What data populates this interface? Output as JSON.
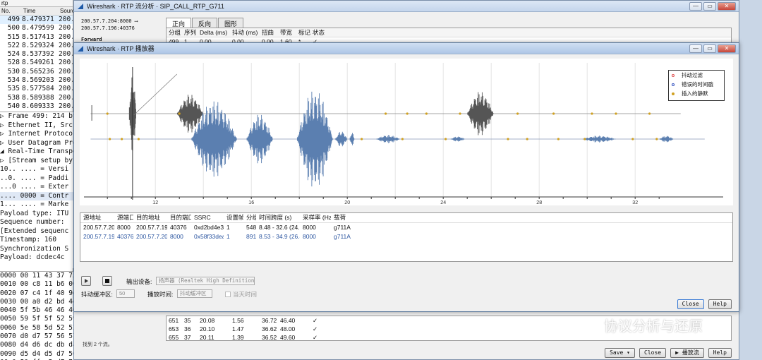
{
  "packet_list": {
    "filter_text": "rtp",
    "columns": [
      "No.",
      "Time",
      "Sourc"
    ],
    "rows": [
      {
        "no": "499",
        "time": "8.479371",
        "src": "200."
      },
      {
        "no": "500",
        "time": "8.479599",
        "src": "200."
      },
      {
        "no": "515",
        "time": "8.517413",
        "src": "200."
      },
      {
        "no": "522",
        "time": "8.529324",
        "src": "200."
      },
      {
        "no": "524",
        "time": "8.537392",
        "src": "200."
      },
      {
        "no": "528",
        "time": "8.549261",
        "src": "200."
      },
      {
        "no": "530",
        "time": "8.565236",
        "src": "200."
      },
      {
        "no": "534",
        "time": "8.569203",
        "src": "200."
      },
      {
        "no": "535",
        "time": "8.577584",
        "src": "200."
      },
      {
        "no": "538",
        "time": "8.589388",
        "src": "200."
      },
      {
        "no": "540",
        "time": "8.609333",
        "src": "200."
      }
    ]
  },
  "packet_tree": [
    "▷ Frame 499: 214 byte",
    "▷ Ethernet II, Src: 0",
    "▷ Internet Protocol V",
    "▷ User Datagram Proto",
    "◢ Real-Time Transport",
    "   ▷ [Stream setup by",
    "     10.. .... = Versi",
    "     ..0. .... = Paddi",
    "     ...0 .... = Exter",
    "     .... 0000 = Contr",
    "     1... .... = Marke",
    "     Payload type: ITU",
    "     Sequence number:",
    "     [Extended sequenc",
    "     Timestamp: 160",
    "     Synchronization S",
    "     Payload: dcdec4c"
  ],
  "hex_dump": [
    {
      "off": "0000",
      "bytes": "00 11 43 37 75"
    },
    {
      "off": "0010",
      "bytes": "00 c8 11 b6 00"
    },
    {
      "off": "0020",
      "bytes": "07 c4 1f 40 9d"
    },
    {
      "off": "0030",
      "bytes": "00 a0 d2 bd 4e"
    },
    {
      "off": "0040",
      "bytes": "5f 5b 46 46 46"
    },
    {
      "off": "0050",
      "bytes": "59 5f 5f 52 59"
    },
    {
      "off": "0060",
      "bytes": "5e 58 5d 52 52"
    },
    {
      "off": "0070",
      "bytes": "d0 d7 57 56 57"
    },
    {
      "off": "0080",
      "bytes": "d4 d6 dc db da"
    },
    {
      "off": "0090",
      "bytes": "d5 d4 d5 d7 50"
    },
    {
      "off": "00a0",
      "bytes": "50 ff e5 d7 74"
    }
  ],
  "rtp_analysis": {
    "title": "Wireshark · RTP 流分析 · SIP_CALL_RTP_G711",
    "stream_info": [
      "200.57.7.204:8000 ⟶",
      "200.57.7.196:40376"
    ],
    "forward_label": "Forward",
    "tabs": [
      "正向",
      "反向",
      "图形"
    ],
    "columns": [
      "分组",
      "序列",
      "Delta (ms)",
      "抖动 (ms)",
      "扭曲",
      "带宽",
      "标记",
      "状态"
    ],
    "first_row": [
      "499",
      "1",
      "0.00",
      "0.00",
      "0.00",
      "1.60",
      "*",
      "✓"
    ],
    "lower_rows": [
      [
        "651",
        "35",
        "20.08",
        "1.56",
        "36.72",
        "46.40",
        "",
        "✓"
      ],
      [
        "653",
        "36",
        "20.10",
        "1.47",
        "36.62",
        "48.00",
        "",
        "✓"
      ],
      [
        "655",
        "37",
        "20.11",
        "1.39",
        "36.52",
        "49.60",
        "",
        "✓"
      ]
    ],
    "status": "找到 2 个流。",
    "buttons": {
      "save": "Save ▾",
      "close": "Close",
      "play": "▶ 播放流",
      "help": "Help"
    },
    "win_btn_min": "—",
    "win_btn_max": "▭",
    "win_btn_close": "✕"
  },
  "rtp_player": {
    "title": "Wireshark · RTP 播放器",
    "legend": [
      {
        "label": "抖动过滤",
        "color": "#e05050"
      },
      {
        "label": "错误的时间戳",
        "color": "#3050c0"
      },
      {
        "label": "插入的静默",
        "color": "#d0a020"
      }
    ],
    "x_ticks": [
      "12",
      "16",
      "20",
      "24",
      "28",
      "32"
    ],
    "stream_columns": [
      "源地址",
      "源端口",
      "目的地址",
      "目的端口",
      "SSRC",
      "设置帧",
      "分组",
      "时间跨度 (s)",
      "采样率 (Hz)",
      "载荷"
    ],
    "streams": [
      [
        "200.57.7.204",
        "8000",
        "200.57.7.196",
        "40376",
        "0xd2bd4e3e",
        "1",
        "548",
        "8.48 - 32.6 (24.1)",
        "8000",
        "g711A"
      ],
      [
        "200.57.7.196",
        "40376",
        "200.57.7.204",
        "8000",
        "0x58f33dea",
        "1",
        "891",
        "8.53 - 34.9 (26.4)",
        "8000",
        "g711A"
      ]
    ],
    "controls": {
      "output_label": "输出设备:",
      "output_value": "扬声器 (Realtek High Definition Au ▾",
      "jitter_label": "抖动缓冲区:",
      "jitter_value": "50",
      "timing_label": "播放时间:",
      "timing_value": "抖动缓冲区",
      "time_of_day": "当天时间"
    },
    "buttons": {
      "close": "Close",
      "help": "Help"
    },
    "win_btn_min": "—",
    "win_btn_max": "▭",
    "win_btn_close": "✕"
  },
  "watermark": "协议分析与还原"
}
